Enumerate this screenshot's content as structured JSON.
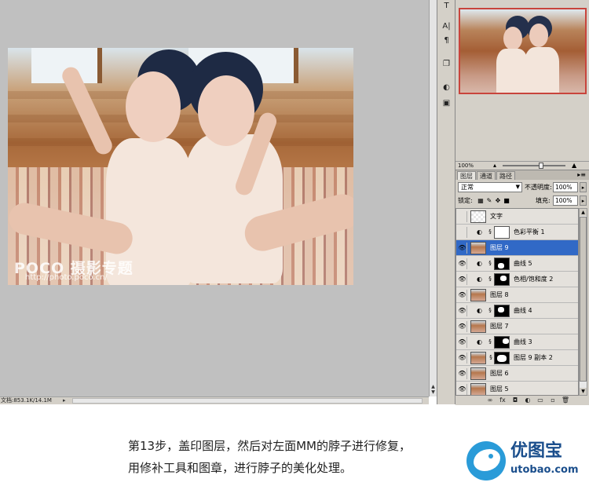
{
  "status": {
    "doc_size": "文档:853.1K/14.1M",
    "arrow": "▸"
  },
  "watermark": {
    "logo": "POCO 摄影专题",
    "url": "http://photo.poco.cn/"
  },
  "tools": [
    "T",
    "A|",
    "¶",
    "❐",
    "◐",
    "▣"
  ],
  "navigator": {
    "zoom": "100%",
    "small_icon": "▴",
    "large_icon": "▲"
  },
  "layers_panel": {
    "tabs": [
      "图层",
      "通道",
      "路径"
    ],
    "active_tab": "图层",
    "menu_icon": "▸≡",
    "blend_mode": "正常",
    "opacity_label": "不透明度:",
    "opacity": "100%",
    "lock_label": "锁定:",
    "fill_label": "填充:",
    "fill": "100%",
    "layers": [
      {
        "name": "文字",
        "visible": false,
        "thumb": "checker",
        "adjustment": false,
        "selected": false
      },
      {
        "name": "色彩平衡 1",
        "visible": false,
        "thumb": "white",
        "adjustment": true,
        "selected": false
      },
      {
        "name": "图层 9",
        "visible": true,
        "thumb": "photo",
        "adjustment": false,
        "selected": true
      },
      {
        "name": "曲线 5",
        "visible": true,
        "thumb": "mask",
        "adjustment": true,
        "selected": false
      },
      {
        "name": "色相/饱和度 2",
        "visible": true,
        "thumb": "mask",
        "adjustment": true,
        "selected": false
      },
      {
        "name": "图层 8",
        "visible": true,
        "thumb": "photo",
        "adjustment": false,
        "selected": false
      },
      {
        "name": "曲线 4",
        "visible": true,
        "thumb": "mask",
        "adjustment": true,
        "selected": false
      },
      {
        "name": "图层 7",
        "visible": true,
        "thumb": "photo",
        "adjustment": false,
        "selected": false
      },
      {
        "name": "曲线 3",
        "visible": true,
        "thumb": "mask",
        "adjustment": true,
        "selected": false
      },
      {
        "name": "图层 9 副本 2",
        "visible": true,
        "thumb": "photo",
        "adjustment": false,
        "selected": false,
        "has_mask": true
      },
      {
        "name": "图层 6",
        "visible": true,
        "thumb": "photo",
        "adjustment": false,
        "selected": false
      },
      {
        "name": "图层 5",
        "visible": true,
        "thumb": "photo",
        "adjustment": false,
        "selected": false
      }
    ],
    "footer_icons": [
      "link-icon",
      "fx-icon",
      "mask-icon",
      "adjustment-icon",
      "group-icon",
      "new-layer-icon",
      "trash-icon"
    ],
    "footer_glyphs": [
      "∞",
      "fx",
      "◘",
      "◐",
      "▭",
      "▫",
      "🗑"
    ]
  },
  "caption": {
    "line1": "第13步，盖印图层，然后对左面MM的脖子进行修复，",
    "line2": "用修补工具和图章，进行脖子的美化处理。"
  },
  "brand": {
    "name": "优图宝",
    "url": "utobao.com"
  },
  "colors": {
    "selected_layer": "#3169c6",
    "navigator_border": "#c8443c",
    "brand": "#1a4e8c",
    "bird": "#2a9bd8"
  }
}
